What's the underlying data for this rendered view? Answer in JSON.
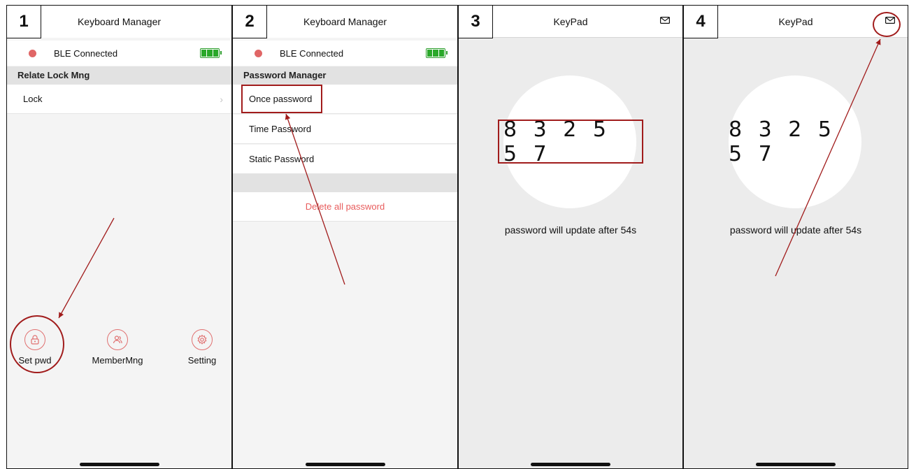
{
  "steps": [
    "1",
    "2",
    "3",
    "4"
  ],
  "screen1": {
    "title": "Keyboard Manager",
    "ble_status": "BLE Connected",
    "section_header": "Relate Lock Mng",
    "list": [
      {
        "label": "Lock",
        "chevron": "›"
      }
    ],
    "tabs": [
      {
        "label": "Set pwd",
        "icon": "lock-icon"
      },
      {
        "label": "MemberMng",
        "icon": "members-icon"
      },
      {
        "label": "Setting",
        "icon": "gear-icon"
      }
    ]
  },
  "screen2": {
    "title": "Keyboard Manager",
    "ble_status": "BLE Connected",
    "section_header": "Password Manager",
    "list": [
      {
        "label": "Once password"
      },
      {
        "label": "Time Password"
      },
      {
        "label": "Static Password"
      }
    ],
    "delete_label": "Delete all password"
  },
  "screen3": {
    "title": "KeyPad",
    "code": "8 3 2 5 5 7",
    "update_text": "password will update after 54s"
  },
  "screen4": {
    "title": "KeyPad",
    "code": "8 3 2 5 5 7",
    "update_text": "password will update after 54s"
  },
  "colors": {
    "annotation_red": "#a11c1c",
    "status_dot": "#e06666",
    "battery_green": "#2aa82a",
    "delete_red": "#e85c5c"
  }
}
